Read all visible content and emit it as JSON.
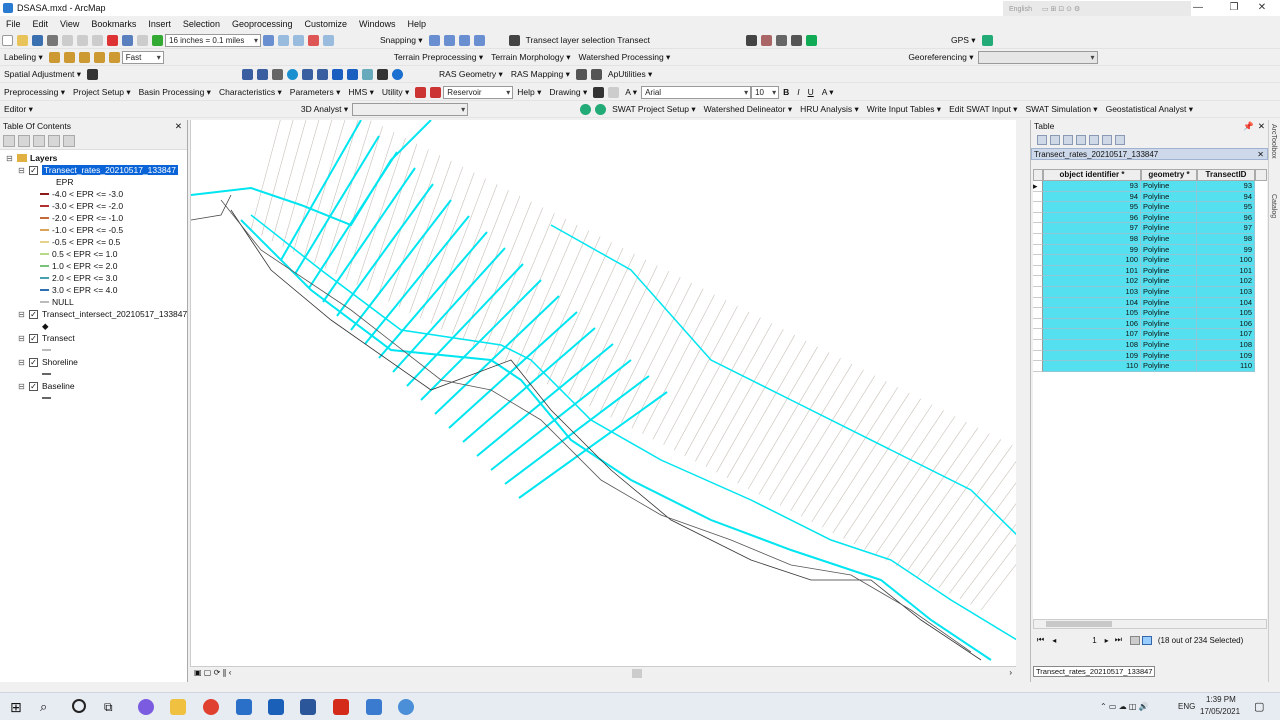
{
  "window": {
    "title": "DSASA.mxd - ArcMap",
    "lang": "English"
  },
  "menu": [
    "File",
    "Edit",
    "View",
    "Bookmarks",
    "Insert",
    "Selection",
    "Geoprocessing",
    "Customize",
    "Windows",
    "Help"
  ],
  "toolbar1": {
    "scale": "16 inches = 0.1 miles",
    "snapping": "Snapping ▾",
    "transect_sel": "Transect layer selection  Transect",
    "gps": "GPS ▾"
  },
  "toolbar2": {
    "labeling": "Labeling ▾",
    "fast": "Fast",
    "terrain": "Terrain Preprocessing ▾",
    "morph": "Terrain Morphology ▾",
    "watershed": "Watershed Processing ▾",
    "georef": "Georeferencing ▾"
  },
  "toolbar3": {
    "spatial": "Spatial Adjustment ▾",
    "ras_geom": "RAS Geometry ▾",
    "ras_map": "RAS Mapping ▾",
    "aputil": "ApUtilities ▾"
  },
  "toolbar4": {
    "items": [
      "Preprocessing ▾",
      "Project Setup ▾",
      "Basin Processing ▾",
      "Characteristics ▾",
      "Parameters ▾",
      "HMS ▾",
      "Utility ▾"
    ],
    "reservoir": "Reservoir",
    "help": "Help ▾",
    "drawing": "Drawing ▾",
    "font": "Arial",
    "size": "10"
  },
  "toolbar5": {
    "editor": "Editor ▾",
    "analyst": "3D Analyst ▾",
    "swat": [
      "SWAT Project Setup ▾",
      "Watershed Delineator ▾",
      "HRU Analysis ▾",
      "Write Input Tables ▾",
      "Edit SWAT Input ▾",
      "SWAT Simulation ▾"
    ],
    "geostat": "Geostatistical Analyst ▾"
  },
  "toc": {
    "header": "Table Of Contents",
    "layers_root": "Layers",
    "layer1": "Transect_rates_20210517_133847",
    "epr": "EPR",
    "classes": [
      {
        "label": "-4.0 < EPR <= -3.0",
        "color": "#8b1a1a"
      },
      {
        "label": "-3.0 < EPR <= -2.0",
        "color": "#b33030"
      },
      {
        "label": "-2.0 < EPR <= -1.0",
        "color": "#c46a3a"
      },
      {
        "label": "-1.0 < EPR <= -0.5",
        "color": "#d9a35a"
      },
      {
        "label": "-0.5 < EPR <= 0.5",
        "color": "#e6d28a"
      },
      {
        "label": "0.5 < EPR <= 1.0",
        "color": "#b8d98a"
      },
      {
        "label": "1.0 < EPR <= 2.0",
        "color": "#7ac27a"
      },
      {
        "label": "2.0 < EPR <= 3.0",
        "color": "#4aa0b0"
      },
      {
        "label": "3.0 < EPR <= 4.0",
        "color": "#2f6fb0"
      },
      {
        "label": "NULL",
        "color": "#bbbbbb"
      }
    ],
    "layer2": "Transect_intersect_20210517_133847",
    "layer3": "Transect",
    "layer4": "Shoreline",
    "layer5": "Baseline"
  },
  "table": {
    "header": "Table",
    "tab": "Transect_rates_20210517_133847",
    "columns": [
      "object identifier *",
      "geometry *",
      "TransectID"
    ],
    "rows": [
      [
        "93",
        "Polyline",
        "93"
      ],
      [
        "94",
        "Polyline",
        "94"
      ],
      [
        "95",
        "Polyline",
        "95"
      ],
      [
        "96",
        "Polyline",
        "96"
      ],
      [
        "97",
        "Polyline",
        "97"
      ],
      [
        "98",
        "Polyline",
        "98"
      ],
      [
        "99",
        "Polyline",
        "99"
      ],
      [
        "100",
        "Polyline",
        "100"
      ],
      [
        "101",
        "Polyline",
        "101"
      ],
      [
        "102",
        "Polyline",
        "102"
      ],
      [
        "103",
        "Polyline",
        "103"
      ],
      [
        "104",
        "Polyline",
        "104"
      ],
      [
        "105",
        "Polyline",
        "105"
      ],
      [
        "106",
        "Polyline",
        "106"
      ],
      [
        "107",
        "Polyline",
        "107"
      ],
      [
        "108",
        "Polyline",
        "108"
      ],
      [
        "109",
        "Polyline",
        "109"
      ],
      [
        "110",
        "Polyline",
        "110"
      ]
    ],
    "page": "1",
    "selection": "(18 out of 234 Selected)",
    "bottom_tab": "Transect_rates_20210517_133847"
  },
  "taskbar": {
    "lang": "ENG",
    "time": "1:39 PM",
    "date": "17/05/2021"
  },
  "colors": {
    "cyan": "#00e5f0",
    "selection": "#54e0ef",
    "grey_line": "#c8c0b8"
  }
}
